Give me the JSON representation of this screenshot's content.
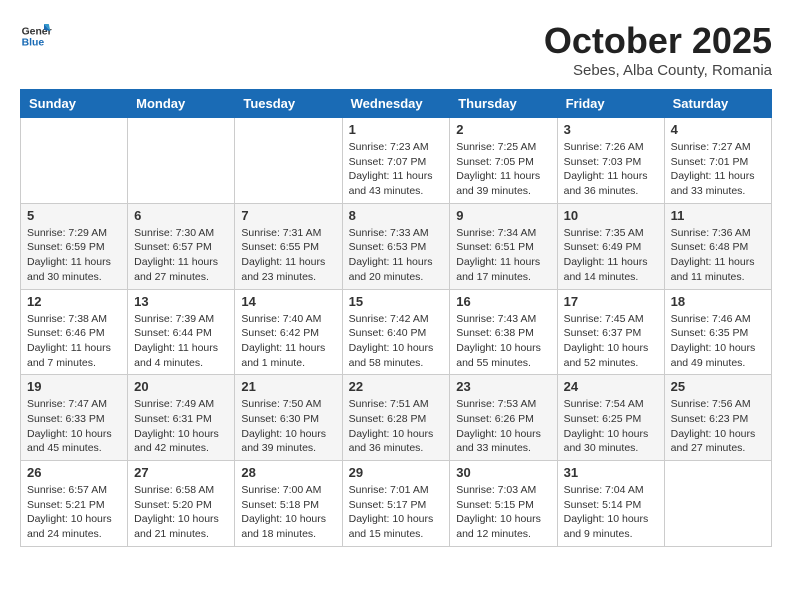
{
  "header": {
    "logo_general": "General",
    "logo_blue": "Blue",
    "month": "October 2025",
    "location": "Sebes, Alba County, Romania"
  },
  "weekdays": [
    "Sunday",
    "Monday",
    "Tuesday",
    "Wednesday",
    "Thursday",
    "Friday",
    "Saturday"
  ],
  "weeks": [
    [
      {
        "day": "",
        "info": ""
      },
      {
        "day": "",
        "info": ""
      },
      {
        "day": "",
        "info": ""
      },
      {
        "day": "1",
        "info": "Sunrise: 7:23 AM\nSunset: 7:07 PM\nDaylight: 11 hours and 43 minutes."
      },
      {
        "day": "2",
        "info": "Sunrise: 7:25 AM\nSunset: 7:05 PM\nDaylight: 11 hours and 39 minutes."
      },
      {
        "day": "3",
        "info": "Sunrise: 7:26 AM\nSunset: 7:03 PM\nDaylight: 11 hours and 36 minutes."
      },
      {
        "day": "4",
        "info": "Sunrise: 7:27 AM\nSunset: 7:01 PM\nDaylight: 11 hours and 33 minutes."
      }
    ],
    [
      {
        "day": "5",
        "info": "Sunrise: 7:29 AM\nSunset: 6:59 PM\nDaylight: 11 hours and 30 minutes."
      },
      {
        "day": "6",
        "info": "Sunrise: 7:30 AM\nSunset: 6:57 PM\nDaylight: 11 hours and 27 minutes."
      },
      {
        "day": "7",
        "info": "Sunrise: 7:31 AM\nSunset: 6:55 PM\nDaylight: 11 hours and 23 minutes."
      },
      {
        "day": "8",
        "info": "Sunrise: 7:33 AM\nSunset: 6:53 PM\nDaylight: 11 hours and 20 minutes."
      },
      {
        "day": "9",
        "info": "Sunrise: 7:34 AM\nSunset: 6:51 PM\nDaylight: 11 hours and 17 minutes."
      },
      {
        "day": "10",
        "info": "Sunrise: 7:35 AM\nSunset: 6:49 PM\nDaylight: 11 hours and 14 minutes."
      },
      {
        "day": "11",
        "info": "Sunrise: 7:36 AM\nSunset: 6:48 PM\nDaylight: 11 hours and 11 minutes."
      }
    ],
    [
      {
        "day": "12",
        "info": "Sunrise: 7:38 AM\nSunset: 6:46 PM\nDaylight: 11 hours and 7 minutes."
      },
      {
        "day": "13",
        "info": "Sunrise: 7:39 AM\nSunset: 6:44 PM\nDaylight: 11 hours and 4 minutes."
      },
      {
        "day": "14",
        "info": "Sunrise: 7:40 AM\nSunset: 6:42 PM\nDaylight: 11 hours and 1 minute."
      },
      {
        "day": "15",
        "info": "Sunrise: 7:42 AM\nSunset: 6:40 PM\nDaylight: 10 hours and 58 minutes."
      },
      {
        "day": "16",
        "info": "Sunrise: 7:43 AM\nSunset: 6:38 PM\nDaylight: 10 hours and 55 minutes."
      },
      {
        "day": "17",
        "info": "Sunrise: 7:45 AM\nSunset: 6:37 PM\nDaylight: 10 hours and 52 minutes."
      },
      {
        "day": "18",
        "info": "Sunrise: 7:46 AM\nSunset: 6:35 PM\nDaylight: 10 hours and 49 minutes."
      }
    ],
    [
      {
        "day": "19",
        "info": "Sunrise: 7:47 AM\nSunset: 6:33 PM\nDaylight: 10 hours and 45 minutes."
      },
      {
        "day": "20",
        "info": "Sunrise: 7:49 AM\nSunset: 6:31 PM\nDaylight: 10 hours and 42 minutes."
      },
      {
        "day": "21",
        "info": "Sunrise: 7:50 AM\nSunset: 6:30 PM\nDaylight: 10 hours and 39 minutes."
      },
      {
        "day": "22",
        "info": "Sunrise: 7:51 AM\nSunset: 6:28 PM\nDaylight: 10 hours and 36 minutes."
      },
      {
        "day": "23",
        "info": "Sunrise: 7:53 AM\nSunset: 6:26 PM\nDaylight: 10 hours and 33 minutes."
      },
      {
        "day": "24",
        "info": "Sunrise: 7:54 AM\nSunset: 6:25 PM\nDaylight: 10 hours and 30 minutes."
      },
      {
        "day": "25",
        "info": "Sunrise: 7:56 AM\nSunset: 6:23 PM\nDaylight: 10 hours and 27 minutes."
      }
    ],
    [
      {
        "day": "26",
        "info": "Sunrise: 6:57 AM\nSunset: 5:21 PM\nDaylight: 10 hours and 24 minutes."
      },
      {
        "day": "27",
        "info": "Sunrise: 6:58 AM\nSunset: 5:20 PM\nDaylight: 10 hours and 21 minutes."
      },
      {
        "day": "28",
        "info": "Sunrise: 7:00 AM\nSunset: 5:18 PM\nDaylight: 10 hours and 18 minutes."
      },
      {
        "day": "29",
        "info": "Sunrise: 7:01 AM\nSunset: 5:17 PM\nDaylight: 10 hours and 15 minutes."
      },
      {
        "day": "30",
        "info": "Sunrise: 7:03 AM\nSunset: 5:15 PM\nDaylight: 10 hours and 12 minutes."
      },
      {
        "day": "31",
        "info": "Sunrise: 7:04 AM\nSunset: 5:14 PM\nDaylight: 10 hours and 9 minutes."
      },
      {
        "day": "",
        "info": ""
      }
    ]
  ]
}
